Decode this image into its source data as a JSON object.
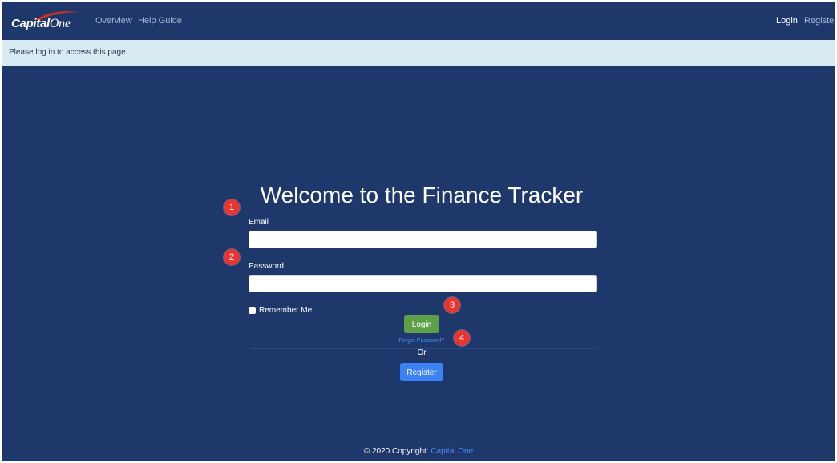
{
  "navbar": {
    "brand_main": "Capital",
    "brand_accent": "One",
    "links": [
      {
        "label": "Overview"
      },
      {
        "label": "Help Guide"
      }
    ],
    "right_links": [
      {
        "label": "Login"
      },
      {
        "label": "Register"
      }
    ]
  },
  "alert": {
    "text": "Please log in to access this page."
  },
  "login_form": {
    "title": "Welcome to the Finance Tracker",
    "email_label": "Email",
    "email_value": "",
    "password_label": "Password",
    "password_value": "",
    "remember_label": "Remember Me",
    "login_button": "Login",
    "forgot_link": "Forgot Password?",
    "or_text": "Or",
    "register_button": "Register"
  },
  "markers": [
    "1",
    "2",
    "3",
    "4"
  ],
  "footer": {
    "text": "© 2020 Copyright:",
    "link": "Capital One"
  },
  "colors": {
    "background": "#1e386b",
    "alert_bg": "#d9ebf2",
    "login_button": "#5ea048",
    "register_button": "#3d82f5",
    "link": "#4a8ff0",
    "marker": "#e8362f",
    "brand_swoosh": "#d22e1e"
  },
  "icons": {
    "brand_logo": "capital-one-swoosh-logo"
  }
}
